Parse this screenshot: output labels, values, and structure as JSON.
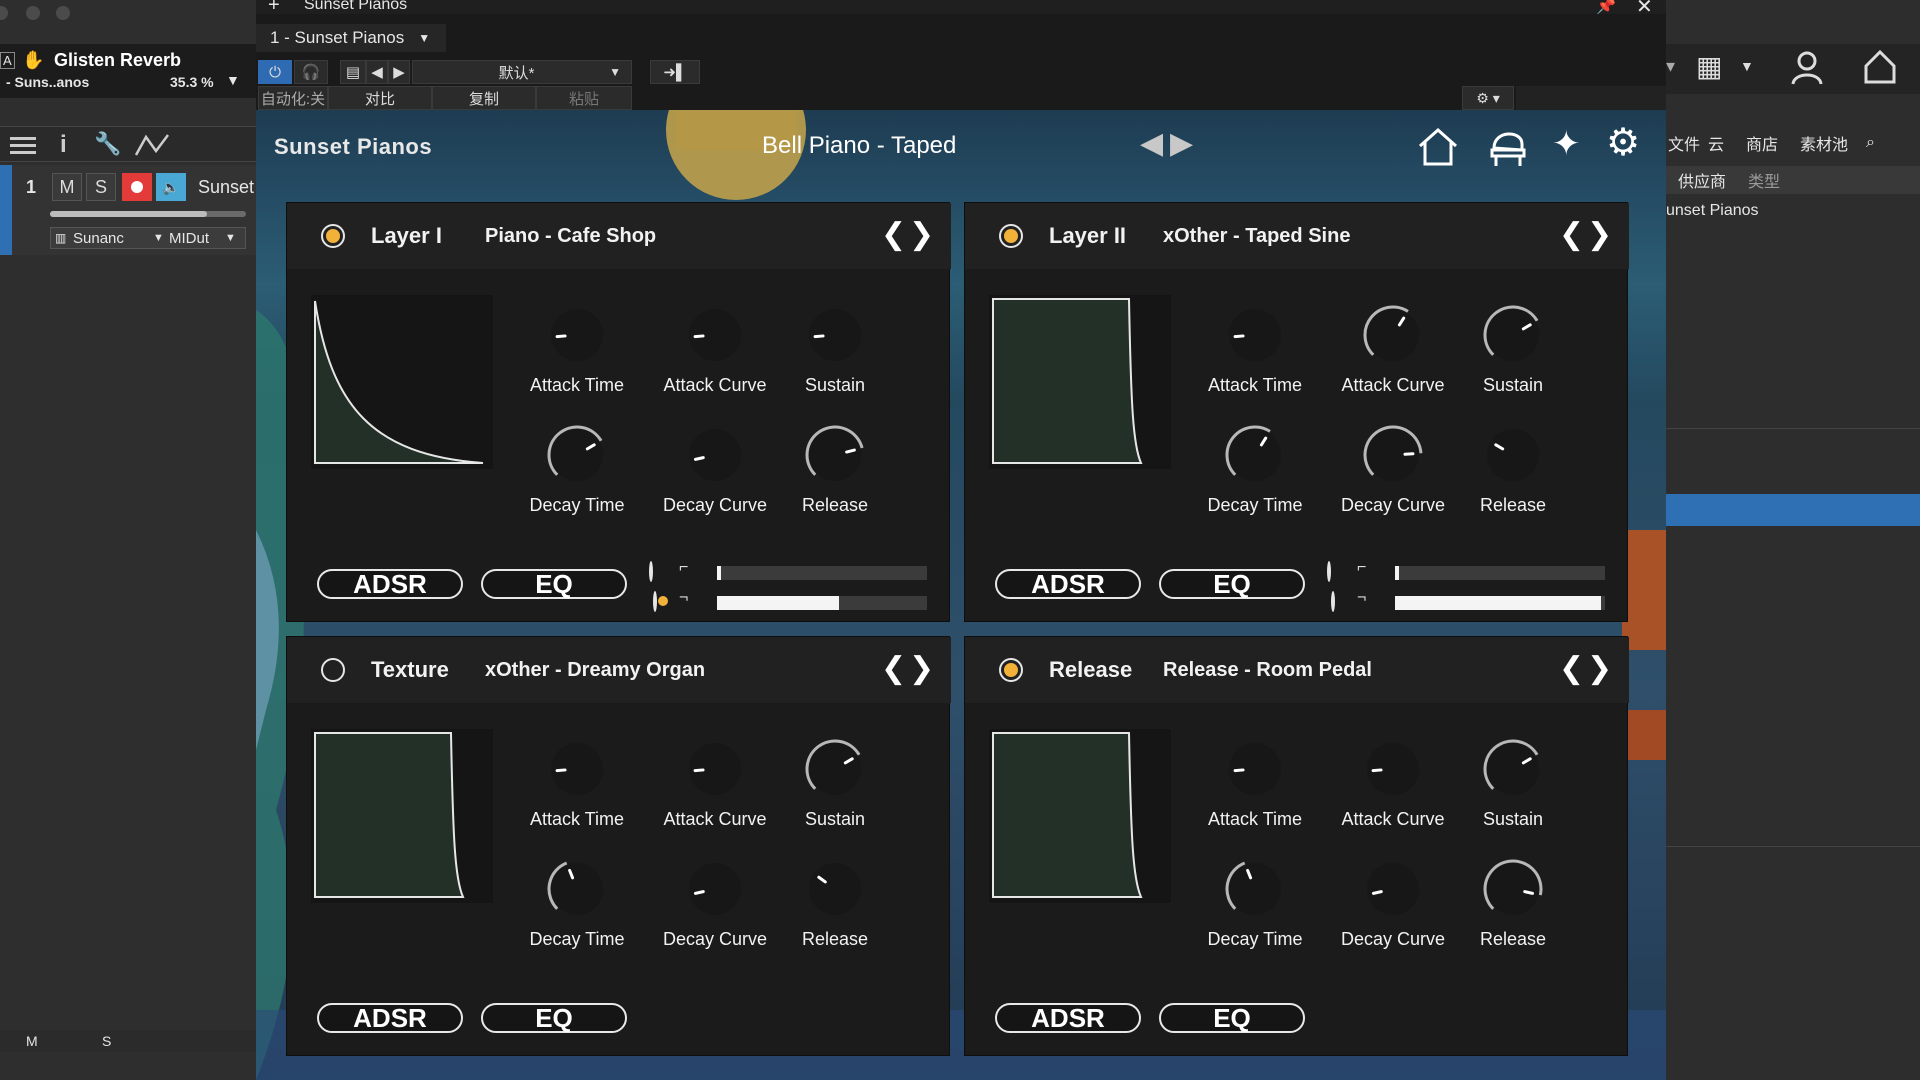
{
  "left": {
    "insert_name": "Glisten Reverb",
    "insert_sub": "- Suns..anos",
    "insert_value": "35.3 %",
    "track_number": "1",
    "mute_label": "M",
    "solo_label": "S",
    "track_name": "Sunset",
    "instrument_select": "Sunanc",
    "midi_select": "MIDut",
    "bottom_m": "M",
    "bottom_s": "S"
  },
  "host": {
    "window_title": "Sunset Pianos",
    "instance_select": "1 - Sunset Pianos",
    "preset_select": "默认*",
    "automation_label": "自动化:关",
    "compare_label": "对比",
    "copy_label": "复制",
    "paste_label": "粘贴"
  },
  "plugin": {
    "brand": "Sunset Pianos",
    "current_preset": "Bell Piano - Taped",
    "adsr_label": "ADSR",
    "eq_label": "EQ",
    "knob_labels": {
      "attack_time": "Attack Time",
      "attack_curve": "Attack Curve",
      "sustain": "Sustain",
      "decay_time": "Decay Time",
      "decay_curve": "Decay Curve",
      "release": "Release"
    },
    "layers": [
      {
        "name": "Layer I",
        "preset": "Piano - Cafe Shop",
        "enabled": true,
        "knobs": {
          "attack_time": 0.15,
          "attack_curve": 0.15,
          "sustain": 0.15,
          "decay_time": 0.72,
          "decay_curve": 0.12,
          "release": 0.78
        },
        "shape": "decay",
        "sliders": [
          {
            "selected": false,
            "value": 0.02
          },
          {
            "selected": true,
            "value": 0.58
          }
        ]
      },
      {
        "name": "Layer II",
        "preset": "xOther - Taped Sine",
        "enabled": true,
        "knobs": {
          "attack_time": 0.15,
          "attack_curve": 0.62,
          "sustain": 0.72,
          "decay_time": 0.62,
          "decay_curve": 0.82,
          "release": 0.28
        },
        "shape": "hold",
        "sliders": [
          {
            "selected": false,
            "value": 0.02
          },
          {
            "selected": false,
            "value": 0.98
          }
        ]
      },
      {
        "name": "Texture",
        "preset": "xOther - Dreamy Organ",
        "enabled": false,
        "knobs": {
          "attack_time": 0.15,
          "attack_curve": 0.15,
          "sustain": 0.72,
          "decay_time": 0.42,
          "decay_curve": 0.12,
          "release": 0.3
        },
        "shape": "hold"
      },
      {
        "name": "Release",
        "preset": "Release - Room Pedal",
        "enabled": true,
        "knobs": {
          "attack_time": 0.15,
          "attack_curve": 0.15,
          "sustain": 0.72,
          "decay_time": 0.42,
          "decay_curve": 0.12,
          "release": 0.88
        },
        "shape": "hold"
      }
    ]
  },
  "right": {
    "tabs": [
      "文件",
      "云",
      "商店",
      "素材池"
    ],
    "columns": [
      "供应商",
      "类型"
    ],
    "item": "unset Pianos"
  },
  "colors": {
    "accent": "#f2b23a",
    "selection": "#2f6fb4",
    "host_blue": "#2e6bb3"
  }
}
